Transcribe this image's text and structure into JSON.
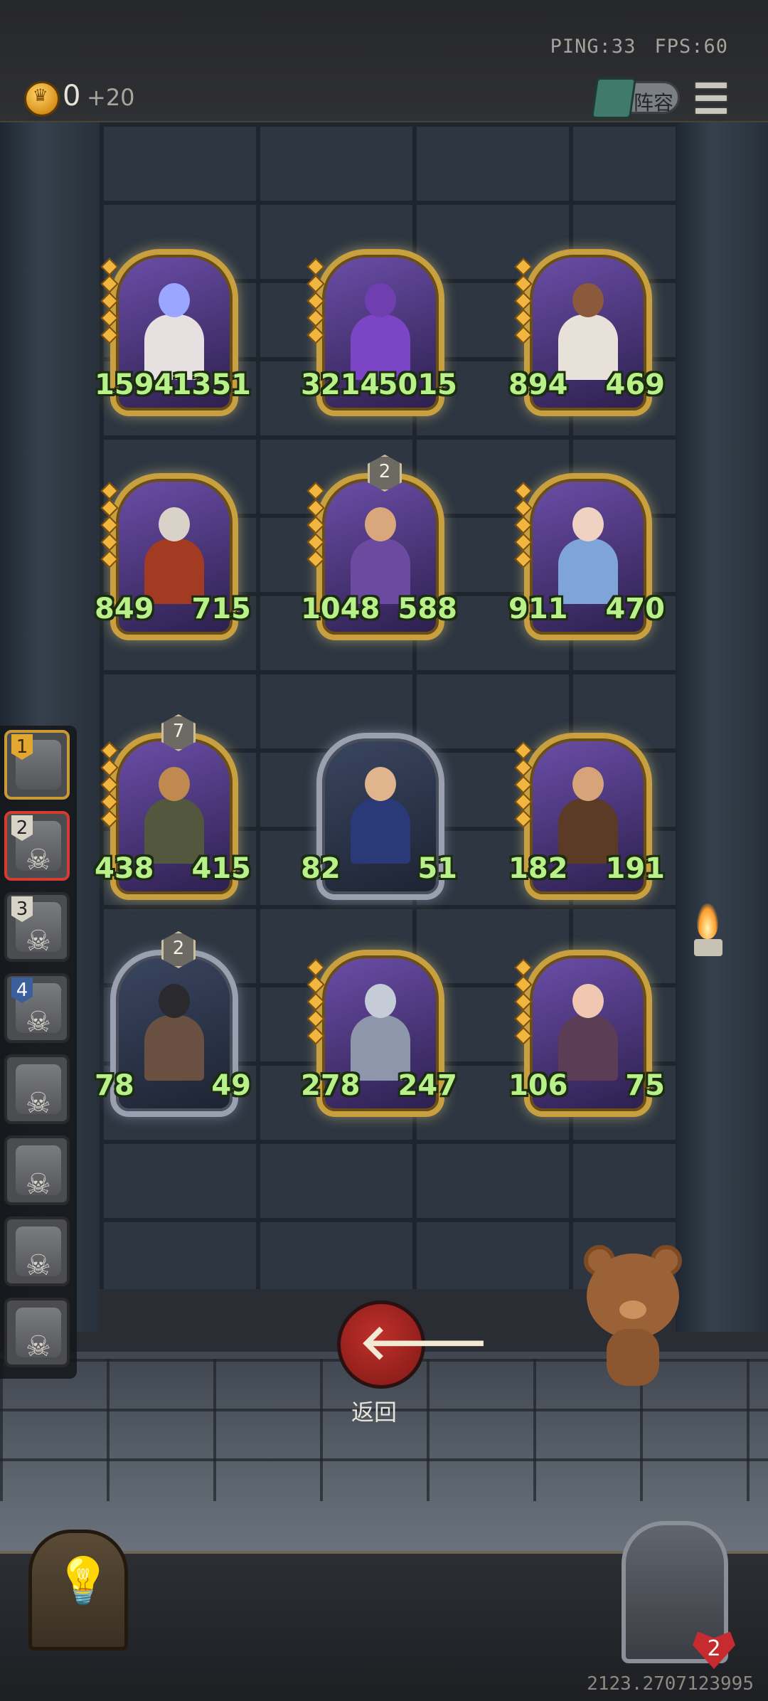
{
  "hud": {
    "ping_label": "PING:33",
    "fps_label": "FPS:60",
    "coins": "0",
    "coin_income": "+20",
    "lineup_label": "阵容"
  },
  "board": [
    {
      "atk": "1594",
      "hp": "1351",
      "tier": "",
      "frame": "gold",
      "head": "#9aa6ff",
      "body": "#e7e0e0"
    },
    {
      "atk": "3214",
      "hp": "5015",
      "tier": "",
      "frame": "gold",
      "head": "#6f3fb0",
      "body": "#7c45c6"
    },
    {
      "atk": "894",
      "hp": "469",
      "tier": "",
      "frame": "gold",
      "head": "#8b5a3c",
      "body": "#e8e1da"
    },
    {
      "atk": "849",
      "hp": "715",
      "tier": "",
      "frame": "gold",
      "head": "#d9d2c8",
      "body": "#a33a22"
    },
    {
      "atk": "1048",
      "hp": "588",
      "tier": "2",
      "frame": "gold",
      "head": "#d9a77c",
      "body": "#6b4aa0"
    },
    {
      "atk": "911",
      "hp": "470",
      "tier": "",
      "frame": "gold",
      "head": "#f0d2c2",
      "body": "#7fa4d8"
    },
    {
      "atk": "438",
      "hp": "415",
      "tier": "7",
      "frame": "gold",
      "head": "#c0894f",
      "body": "#53573d"
    },
    {
      "atk": "82",
      "hp": "51",
      "tier": "",
      "frame": "silver",
      "head": "#e0b48c",
      "body": "#2a3a78"
    },
    {
      "atk": "182",
      "hp": "191",
      "tier": "",
      "frame": "gold",
      "head": "#d7a47a",
      "body": "#5b3b26"
    },
    {
      "atk": "78",
      "hp": "49",
      "tier": "2",
      "frame": "silver",
      "head": "#2a2a2e",
      "body": "#6a5040"
    },
    {
      "atk": "278",
      "hp": "247",
      "tier": "",
      "frame": "gold",
      "head": "#c5cbd7",
      "body": "#8d96aa"
    },
    {
      "atk": "106",
      "hp": "75",
      "tier": "",
      "frame": "gold",
      "head": "#f0c8b2",
      "body": "#5b3d55"
    }
  ],
  "roster": [
    {
      "num": "1",
      "style": "y",
      "state": "gold",
      "skull": false
    },
    {
      "num": "2",
      "style": "w",
      "state": "red",
      "skull": true
    },
    {
      "num": "3",
      "style": "w",
      "state": "",
      "skull": true
    },
    {
      "num": "4",
      "style": "",
      "state": "",
      "skull": true
    },
    {
      "num": "",
      "style": "",
      "state": "",
      "skull": true
    },
    {
      "num": "",
      "style": "",
      "state": "",
      "skull": true
    },
    {
      "num": "",
      "style": "",
      "state": "",
      "skull": true
    },
    {
      "num": "",
      "style": "",
      "state": "",
      "skull": true
    }
  ],
  "back": {
    "icon": "arrow-left-icon",
    "label": "返回"
  },
  "player": {
    "lives": "2"
  },
  "footer": {
    "seed": "2123.2707123995"
  }
}
